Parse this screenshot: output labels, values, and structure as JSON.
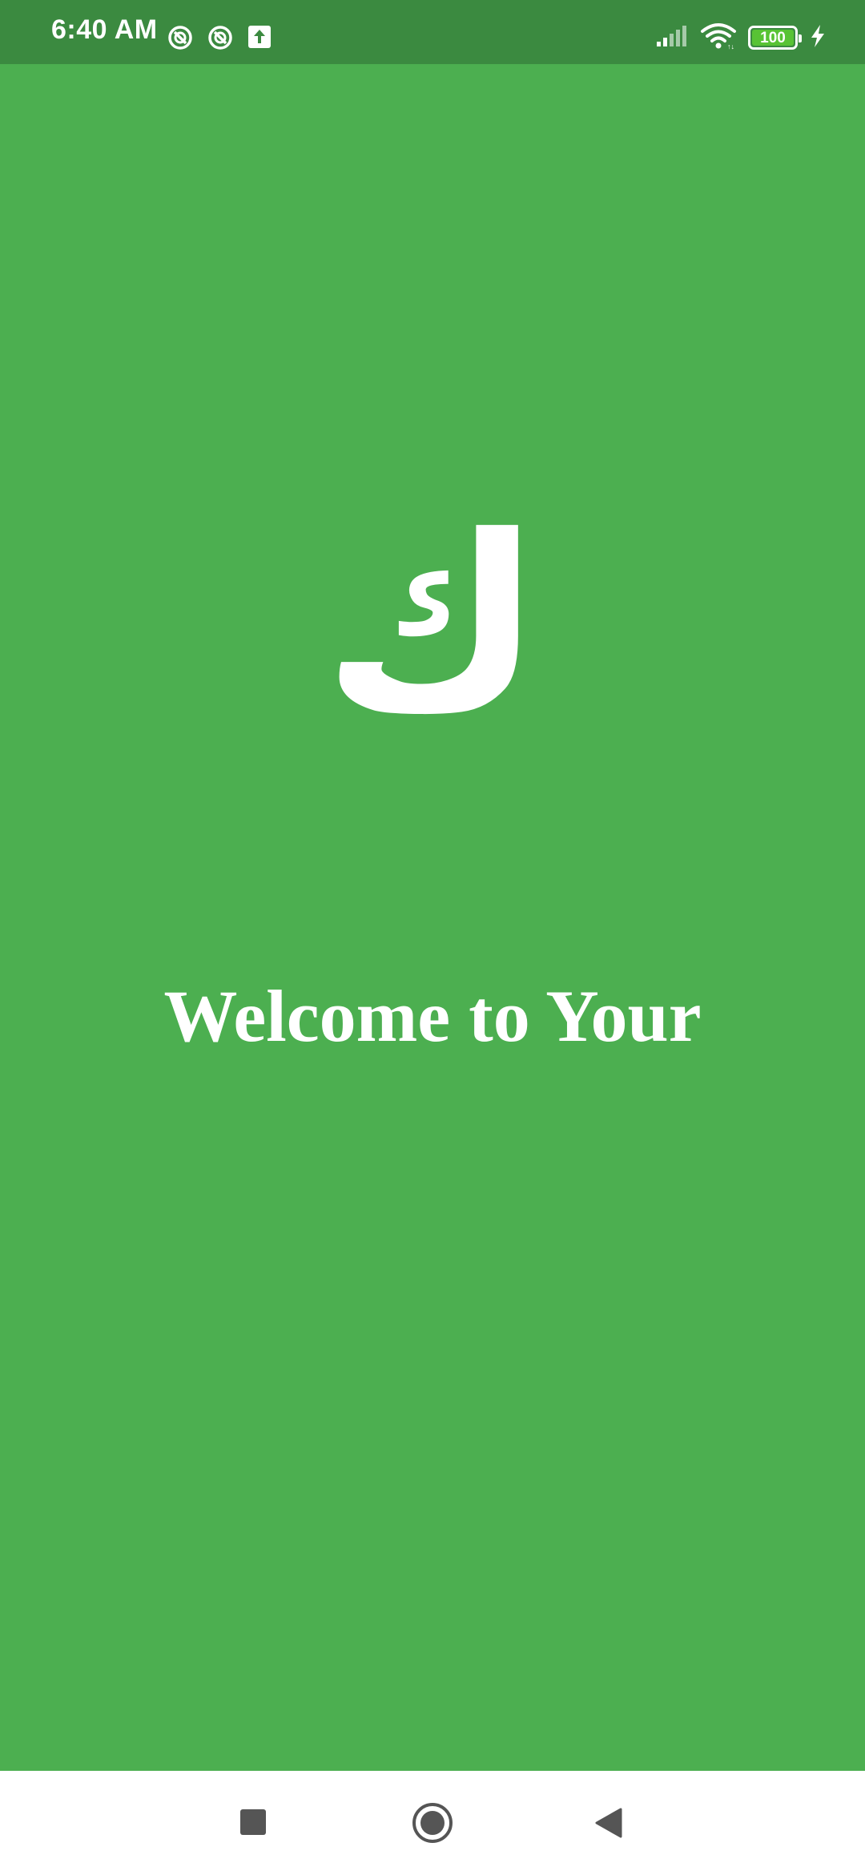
{
  "status_bar": {
    "time": "6:40 AM",
    "left_icons": [
      "privacy-ring-icon",
      "privacy-ring-icon",
      "upload-box-icon"
    ],
    "right_icons": [
      "signal-icon",
      "wifi-icon",
      "battery-icon",
      "charging-bolt-icon"
    ],
    "battery_level": "100"
  },
  "splash": {
    "logo_glyph": "ك",
    "welcome_text": "Welcome to Your"
  },
  "nav_bar": {
    "buttons": [
      "recents-button",
      "home-button",
      "back-button"
    ]
  },
  "colors": {
    "background": "#4caf50",
    "status_bar": "#3b8a40",
    "text": "#ffffff",
    "battery_fill": "#58c334",
    "nav_bar": "#ffffff",
    "nav_icons": "#555555"
  }
}
